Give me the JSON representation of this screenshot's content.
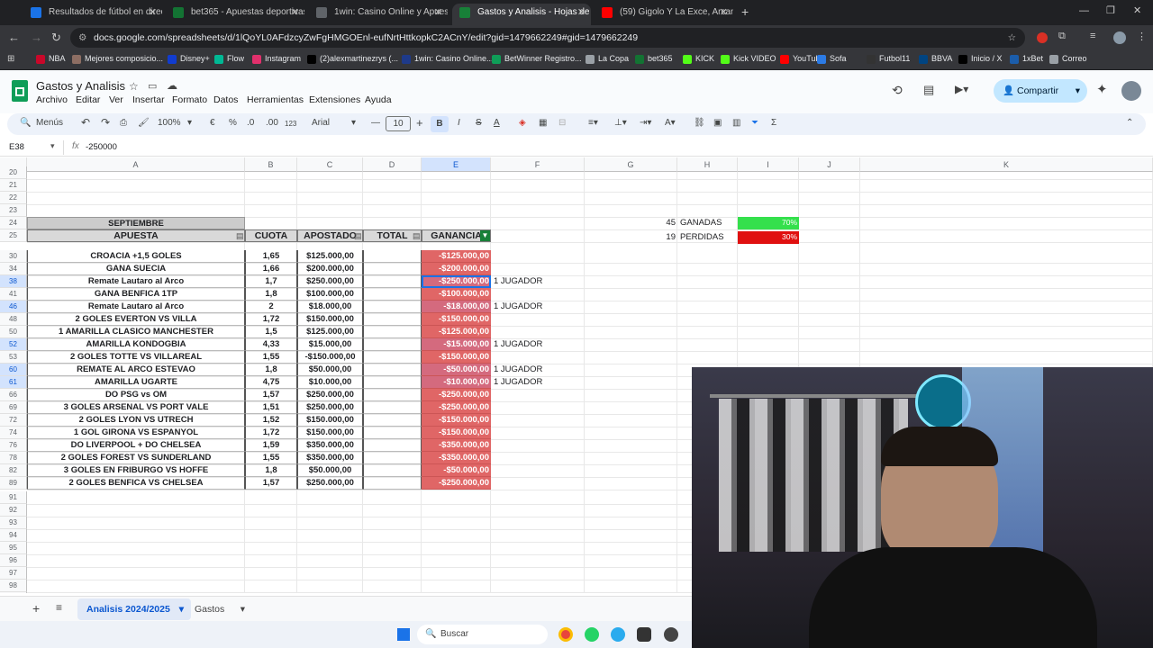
{
  "browser": {
    "tabs": [
      {
        "label": "Resultados de fútbol en directo",
        "color": "#1a73e8"
      },
      {
        "label": "bet365 - Apuestas deportivas e",
        "color": "#137333"
      },
      {
        "label": "1win: Casino Online y Apuestas",
        "color": "#5f6368"
      },
      {
        "label": "Gastos y Analisis - Hojas de cálc",
        "color": "#188038"
      },
      {
        "label": "(59) Gigolo Y La Exce, Arcangel",
        "color": "#ff0000"
      }
    ],
    "url": "docs.google.com/spreadsheets/d/1lQoYL0AFdzcyZwFgHMGOEnl-eufNrtHttkopkC2ACnY/edit?gid=1479662249#gid=1479662249",
    "bookmarks": [
      {
        "label": "NBA",
        "color": "#c9082a"
      },
      {
        "label": "Mejores composicio...",
        "color": "#8d6e63"
      },
      {
        "label": "Disney+",
        "color": "#113ccf"
      },
      {
        "label": "Flow",
        "color": "#00b894"
      },
      {
        "label": "Instagram",
        "color": "#e1306c"
      },
      {
        "label": "(2)alexmartinezrys (...",
        "color": "#000000"
      },
      {
        "label": "1win: Casino Online...",
        "color": "#1e3a8a"
      },
      {
        "label": "BetWinner Registro...",
        "color": "#0f9d58"
      },
      {
        "label": "La Copa",
        "color": "#9aa0a6"
      },
      {
        "label": "bet365",
        "color": "#137333"
      },
      {
        "label": "KICK",
        "color": "#53fc18"
      },
      {
        "label": "Kick VIDEO",
        "color": "#53fc18"
      },
      {
        "label": "YouTube",
        "color": "#ff0000"
      },
      {
        "label": "Sofa",
        "color": "#2c7be5"
      },
      {
        "label": "Futbol11",
        "color": "#333333"
      },
      {
        "label": "BBVA",
        "color": "#004481"
      },
      {
        "label": "Inicio / X",
        "color": "#000000"
      },
      {
        "label": "1xBet",
        "color": "#1b5dab"
      },
      {
        "label": "Correo",
        "color": "#9aa0a6"
      }
    ]
  },
  "sheets": {
    "title": "Gastos y Analisis",
    "menus": [
      "Archivo",
      "Editar",
      "Ver",
      "Insertar",
      "Formato",
      "Datos",
      "Herramientas",
      "Extensiones",
      "Ayuda"
    ],
    "share_label": "Compartir",
    "toolbar": {
      "menus_label": "Menús",
      "zoom": "100%",
      "currency": "€",
      "percent": "%",
      "dec_less": ".0",
      "dec_more": ".00",
      "num_fmt": "123",
      "font": "Arial",
      "font_size": "10"
    },
    "cell_ref": "E38",
    "formula": "-250000",
    "columns": [
      "A",
      "B",
      "C",
      "D",
      "E",
      "F",
      "G",
      "H",
      "I",
      "J",
      "K"
    ],
    "table": {
      "month": "SEPTIEMBRE",
      "headers": [
        "APUESTA",
        "CUOTA",
        "APOSTADO",
        "TOTAL",
        "GANANCIA"
      ],
      "rows": [
        {
          "n": "30",
          "a": "CROACIA +1,5 GOLES",
          "b": "1,65",
          "c": "$125.000,00",
          "e": "-$125.000,00",
          "f": ""
        },
        {
          "n": "34",
          "a": "GANA SUECIA",
          "b": "1,66",
          "c": "$200.000,00",
          "e": "-$200.000,00",
          "f": ""
        },
        {
          "n": "38",
          "a": "Remate Lautaro al Arco",
          "b": "1,7",
          "c": "$250.000,00",
          "e": "-$250.000,00",
          "f": "1 JUGADOR"
        },
        {
          "n": "41",
          "a": "GANA BENFICA 1TP",
          "b": "1,8",
          "c": "$100.000,00",
          "e": "-$100.000,00",
          "f": ""
        },
        {
          "n": "46",
          "a": "Remate Lautaro al Arco",
          "b": "2",
          "c": "$18.000,00",
          "e": "-$18.000,00",
          "f": "1 JUGADOR"
        },
        {
          "n": "48",
          "a": "2 GOLES EVERTON VS VILLA",
          "b": "1,72",
          "c": "$150.000,00",
          "e": "-$150.000,00",
          "f": ""
        },
        {
          "n": "50",
          "a": "1 AMARILLA CLASICO MANCHESTER",
          "b": "1,5",
          "c": "$125.000,00",
          "e": "-$125.000,00",
          "f": ""
        },
        {
          "n": "52",
          "a": "AMARILLA KONDOGBIA",
          "b": "4,33",
          "c": "$15.000,00",
          "e": "-$15.000,00",
          "f": "1 JUGADOR"
        },
        {
          "n": "53",
          "a": "2 GOLES TOTTE VS VILLAREAL",
          "b": "1,55",
          "c": "-$150.000,00",
          "e": "-$150.000,00",
          "f": ""
        },
        {
          "n": "60",
          "a": "REMATE AL ARCO ESTEVAO",
          "b": "1,8",
          "c": "$50.000,00",
          "e": "-$50.000,00",
          "f": "1 JUGADOR"
        },
        {
          "n": "61",
          "a": "AMARILLA UGARTE",
          "b": "4,75",
          "c": "$10.000,00",
          "e": "-$10.000,00",
          "f": "1 JUGADOR"
        },
        {
          "n": "66",
          "a": "DO PSG vs OM",
          "b": "1,57",
          "c": "$250.000,00",
          "e": "-$250.000,00",
          "f": ""
        },
        {
          "n": "69",
          "a": "3 GOLES ARSENAL VS PORT VALE",
          "b": "1,51",
          "c": "$250.000,00",
          "e": "-$250.000,00",
          "f": ""
        },
        {
          "n": "72",
          "a": "2 GOLES LYON VS UTRECH",
          "b": "1,52",
          "c": "$150.000,00",
          "e": "-$150.000,00",
          "f": ""
        },
        {
          "n": "74",
          "a": "1 GOL GIRONA VS ESPANYOL",
          "b": "1,72",
          "c": "$150.000,00",
          "e": "-$150.000,00",
          "f": ""
        },
        {
          "n": "76",
          "a": "DO LIVERPOOL + DO CHELSEA",
          "b": "1,59",
          "c": "$350.000,00",
          "e": "-$350.000,00",
          "f": ""
        },
        {
          "n": "78",
          "a": "2 GOLES FOREST VS SUNDERLAND",
          "b": "1,55",
          "c": "$350.000,00",
          "e": "-$350.000,00",
          "f": ""
        },
        {
          "n": "82",
          "a": "3 GOLES EN FRIBURGO VS HOFFE",
          "b": "1,8",
          "c": "$50.000,00",
          "e": "-$50.000,00",
          "f": ""
        },
        {
          "n": "89",
          "a": "2 GOLES BENFICA VS CHELSEA",
          "b": "1,57",
          "c": "$250.000,00",
          "e": "-$250.000,00",
          "f": ""
        }
      ],
      "top_rows": [
        "20",
        "21",
        "22",
        "23",
        "24",
        "25"
      ],
      "bottom_rows": [
        "91",
        "92",
        "93",
        "94",
        "95",
        "96",
        "97",
        "98",
        "99"
      ]
    },
    "summary": {
      "won_count": "45",
      "won_label": "GANADAS",
      "won_pct": "70%",
      "won_color": "#34e04c",
      "lost_count": "19",
      "lost_label": "PERDIDAS",
      "lost_pct": "30%",
      "lost_color": "#e01010"
    },
    "sheet_tabs": [
      "Analisis 2024/2025",
      "Gastos"
    ]
  },
  "taskbar": {
    "search": "Buscar"
  }
}
